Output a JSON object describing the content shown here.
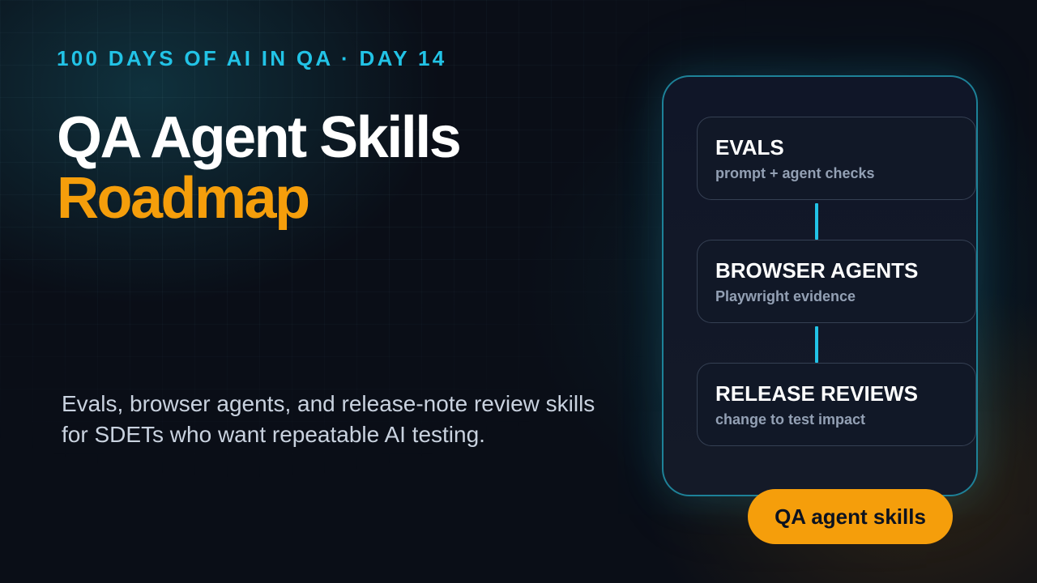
{
  "header": {
    "series_label": "100 DAYS OF AI IN QA · DAY 14",
    "title_line_1": "QA Agent Skills",
    "title_line_2": "Roadmap"
  },
  "description": "Evals, browser agents, and release-note review skills for SDETs who want repeatable AI testing.",
  "roadmap": {
    "steps": [
      {
        "title": "EVALS",
        "subtitle": "prompt + agent checks"
      },
      {
        "title": "BROWSER AGENTS",
        "subtitle": "Playwright evidence"
      },
      {
        "title": "RELEASE REVIEWS",
        "subtitle": "change to test impact"
      }
    ],
    "badge": "QA agent skills"
  },
  "colors": {
    "background": "#0a0e17",
    "accent_cyan": "#22c3e6",
    "accent_orange": "#f59e0b",
    "title_white": "#ffffff",
    "body_text": "#c9d2df",
    "card_subtitle": "#93a0b4"
  }
}
